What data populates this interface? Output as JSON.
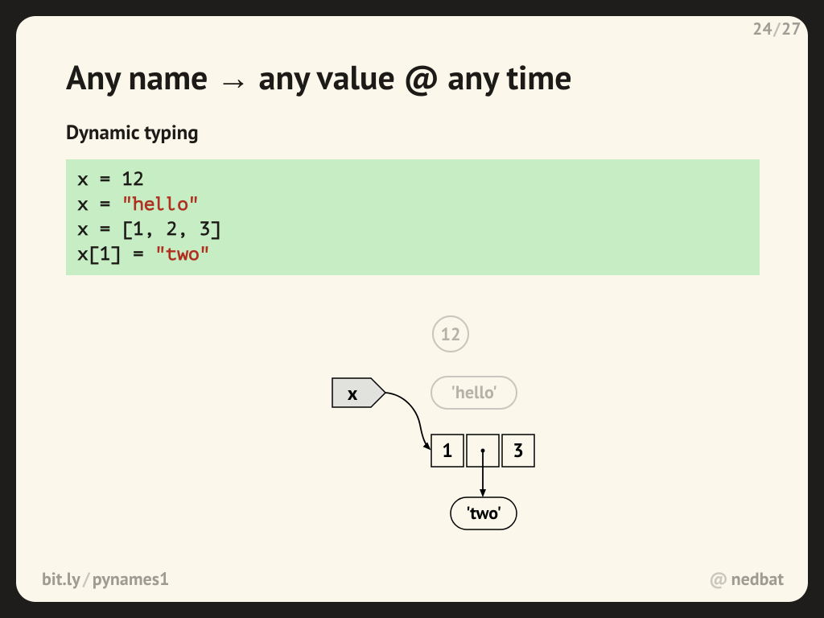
{
  "page": {
    "current": "24",
    "total": "27"
  },
  "title": "Any name → any value @ any time",
  "subtitle": "Dynamic typing",
  "code": {
    "l1": "x = 12",
    "l2a": "x = ",
    "l2b": "\"hello\"",
    "l3": "x = [1, 2, 3]",
    "l4a": "x[1] = ",
    "l4b": "\"two\""
  },
  "diagram": {
    "name": "x",
    "orphan_int": "12",
    "orphan_str": "'hello'",
    "list": [
      "1",
      "",
      "3"
    ],
    "list_dot": "•",
    "referenced_str": "'two'"
  },
  "footer": {
    "url_a": "bit.ly",
    "url_b": "pynames1"
  },
  "handle": {
    "at": "@",
    "name": "nedbat"
  }
}
